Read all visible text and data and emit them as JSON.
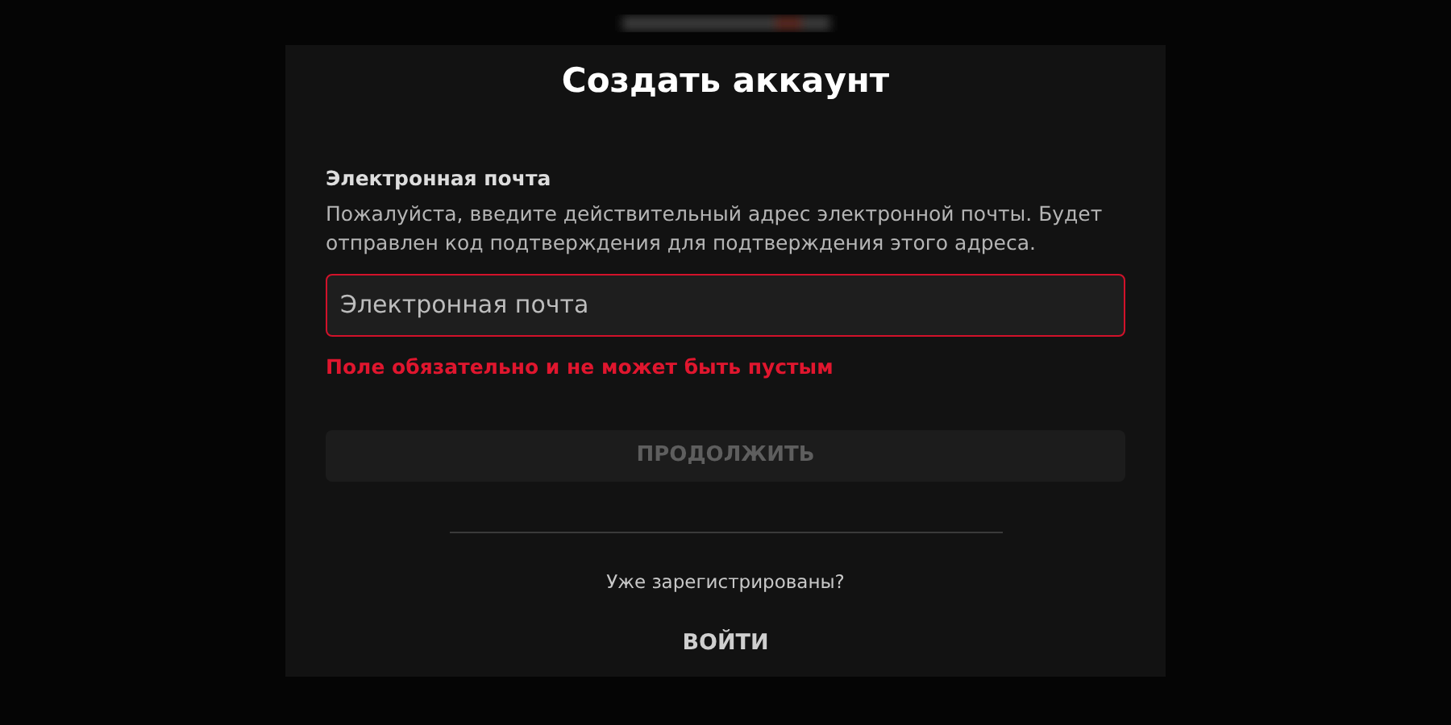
{
  "title": "Создать аккаунт",
  "email": {
    "label": "Электронная почта",
    "hint": "Пожалуйста, введите действительный адрес электронной почты. Будет отправлен код подтверждения для подтверждения этого адреса.",
    "placeholder": "Электронная почта",
    "invalid": true,
    "error": "Поле обязательно и не может быть пустым"
  },
  "continue_button": {
    "label": "ПРОДОЛЖИТЬ",
    "disabled": true
  },
  "login_prompt": "Уже зарегистрированы?",
  "login_button": {
    "label": "ВОЙТИ"
  }
}
